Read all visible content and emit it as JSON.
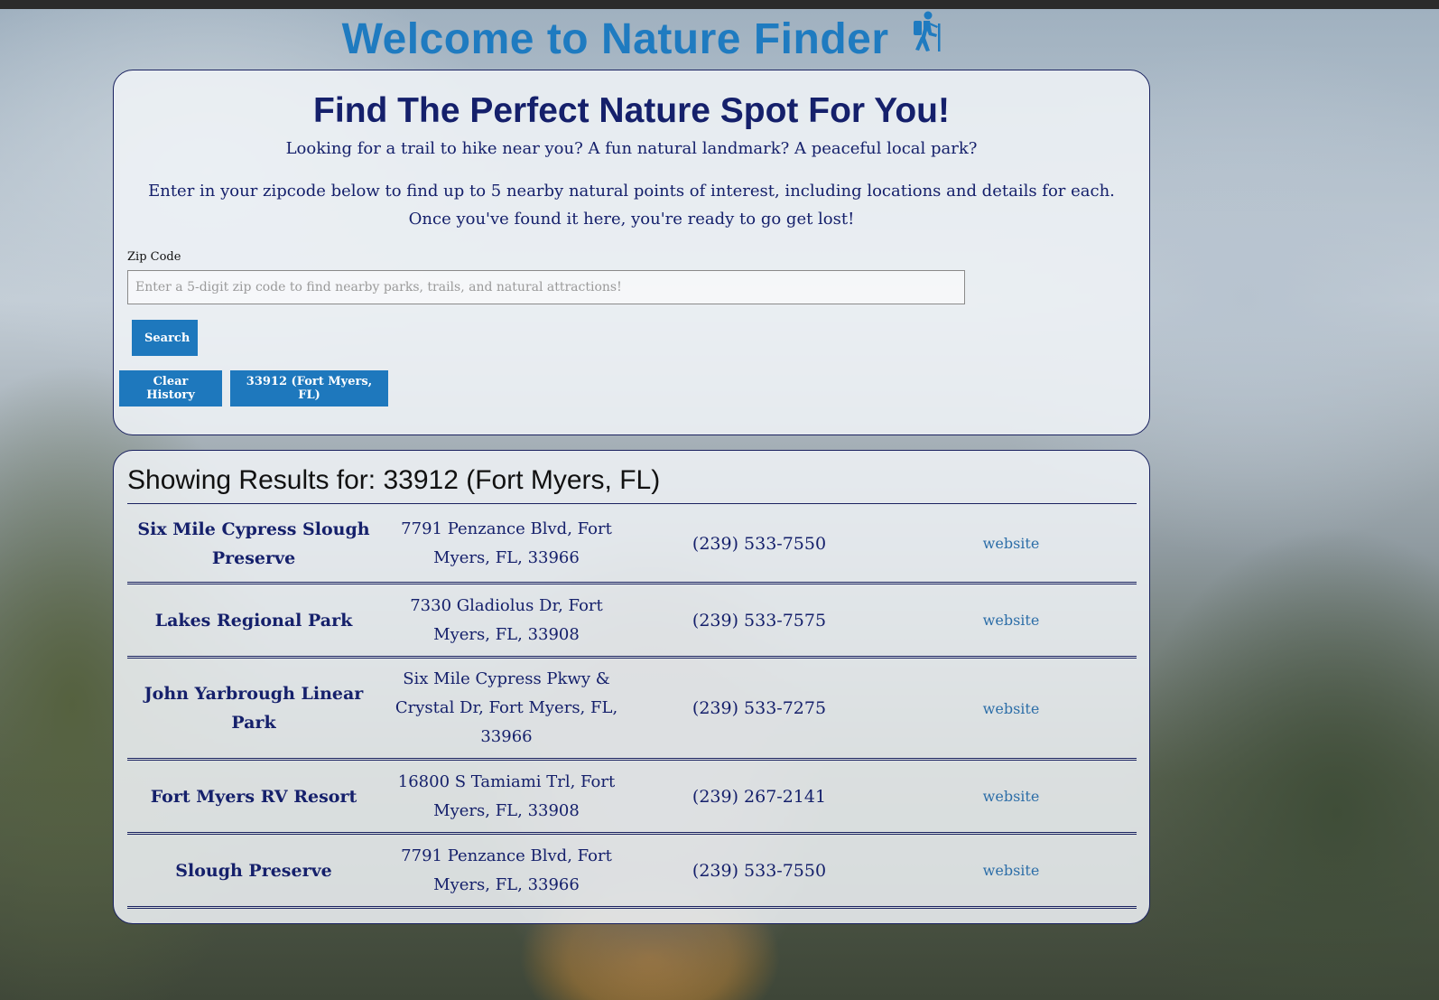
{
  "header": {
    "title": "Welcome to Nature Finder"
  },
  "search": {
    "heading": "Find The Perfect Nature Spot For You!",
    "intro": "Looking for a trail to hike near you? A fun natural landmark? A peaceful local park?",
    "details": "Enter in your zipcode below to find up to 5 nearby natural points of interest, including locations and details for each. Once you've found it here, you're ready to go get lost!",
    "zip_label": "Zip Code",
    "zip_value": "",
    "zip_placeholder": "Enter a 5-digit zip code to find nearby parks, trails, and natural attractions!",
    "search_button": "Search",
    "clear_history_button": "Clear History",
    "history": [
      "33912 (Fort Myers, FL)"
    ]
  },
  "results": {
    "heading": "Showing Results for: 33912 (Fort Myers, FL)",
    "items": [
      {
        "name": "Six Mile Cypress Slough Preserve",
        "address": "7791 Penzance Blvd, Fort Myers, FL, 33966",
        "phone": "(239) 533-7550",
        "link": "website"
      },
      {
        "name": "Lakes Regional Park",
        "address": "7330 Gladiolus Dr, Fort Myers, FL, 33908",
        "phone": "(239) 533-7575",
        "link": "website"
      },
      {
        "name": "John Yarbrough Linear Park",
        "address": "Six Mile Cypress Pkwy & Crystal Dr, Fort Myers, FL, 33966",
        "phone": "(239) 533-7275",
        "link": "website"
      },
      {
        "name": "Fort Myers RV Resort",
        "address": "16800 S Tamiami Trl, Fort Myers, FL, 33908",
        "phone": "(239) 267-2141",
        "link": "website"
      },
      {
        "name": "Slough Preserve",
        "address": "7791 Penzance Blvd, Fort Myers, FL, 33966",
        "phone": "(239) 533-7550",
        "link": "website"
      }
    ]
  },
  "icons": {
    "title_icon": "hiker-icon"
  },
  "colors": {
    "title_blue": "#1f7bc0",
    "heading_navy": "#15206b",
    "button_blue": "#1e78bd",
    "link_blue": "#2d6ea8"
  }
}
